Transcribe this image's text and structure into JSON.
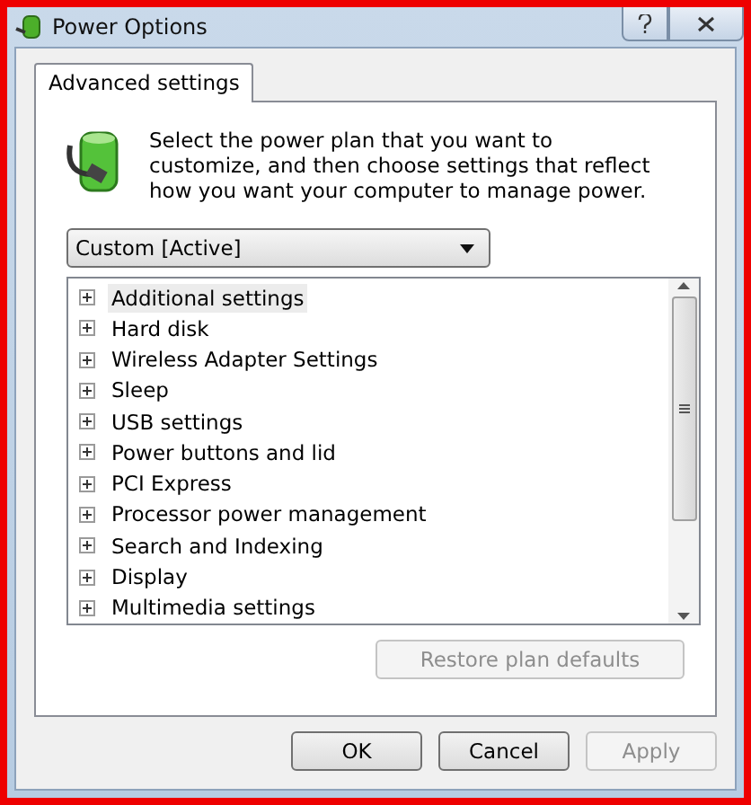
{
  "window": {
    "title": "Power Options"
  },
  "tabs": [
    {
      "label": "Advanced settings",
      "selected": true
    }
  ],
  "description": "Select the power plan that you want to customize, and then choose settings that reflect how you want your computer to manage power.",
  "plan_dropdown": {
    "value": "Custom [Active]"
  },
  "settings_tree": [
    {
      "label": "Additional settings",
      "expanded": false,
      "selected": true
    },
    {
      "label": "Hard disk",
      "expanded": false,
      "selected": false
    },
    {
      "label": "Wireless Adapter Settings",
      "expanded": false,
      "selected": false
    },
    {
      "label": "Sleep",
      "expanded": false,
      "selected": false
    },
    {
      "label": "USB settings",
      "expanded": false,
      "selected": false
    },
    {
      "label": "Power buttons and lid",
      "expanded": false,
      "selected": false
    },
    {
      "label": "PCI Express",
      "expanded": false,
      "selected": false
    },
    {
      "label": "Processor power management",
      "expanded": false,
      "selected": false
    },
    {
      "label": "Search and Indexing",
      "expanded": false,
      "selected": false
    },
    {
      "label": "Display",
      "expanded": false,
      "selected": false
    },
    {
      "label": "Multimedia settings",
      "expanded": false,
      "selected": false
    }
  ],
  "restore_button": {
    "label": "Restore plan defaults",
    "disabled": true
  },
  "buttons": [
    {
      "label": "OK",
      "disabled": false
    },
    {
      "label": "Cancel",
      "disabled": false
    },
    {
      "label": "Apply",
      "disabled": true
    }
  ]
}
